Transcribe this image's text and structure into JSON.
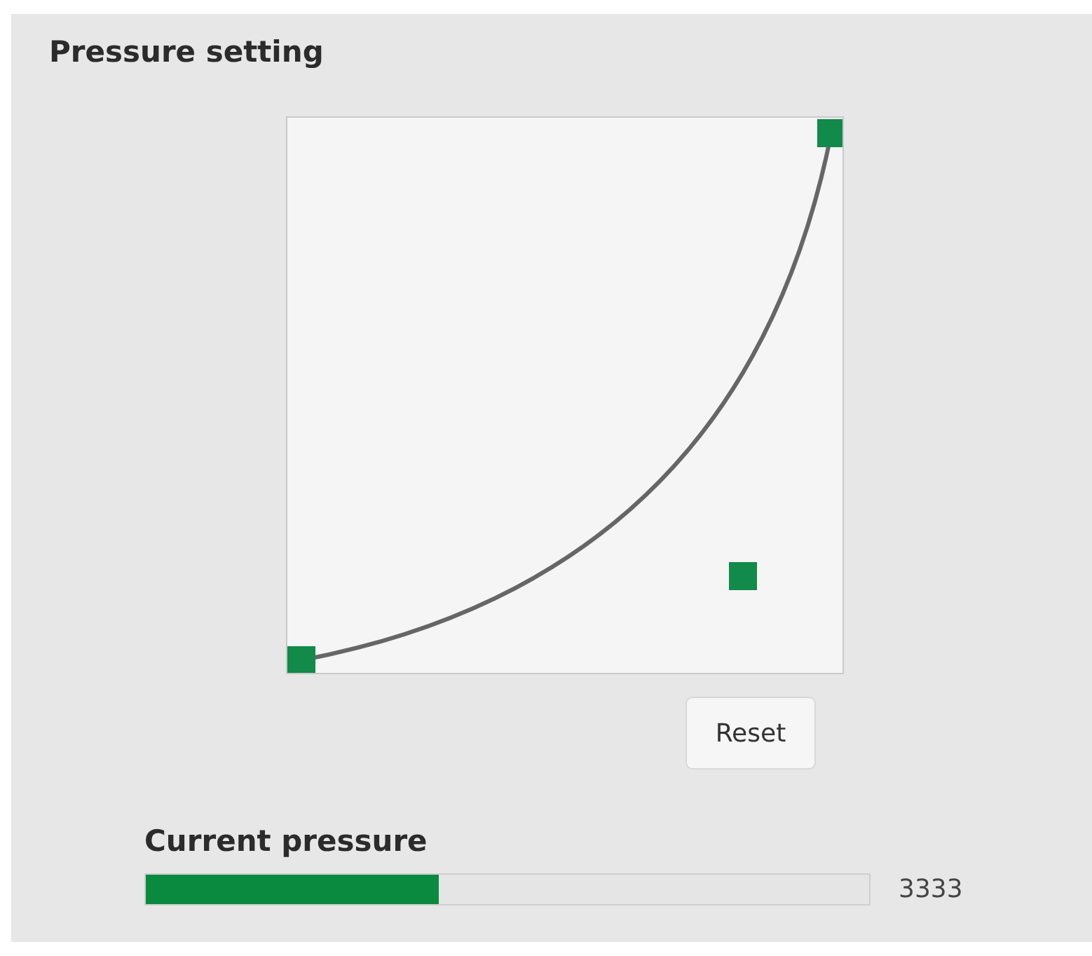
{
  "title": "Pressure setting",
  "reset_button": "Reset",
  "current_pressure": {
    "label": "Current pressure",
    "level": 0.405,
    "reading": "3333"
  }
}
